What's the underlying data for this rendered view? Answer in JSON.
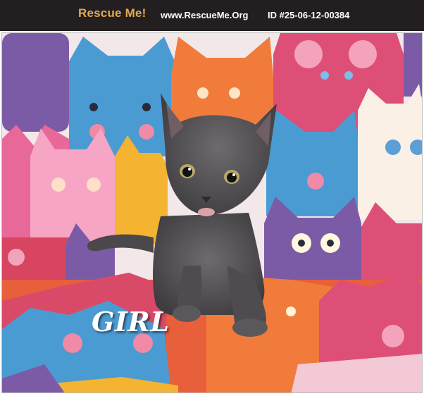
{
  "header": {
    "logo_text": "Rescue Me!",
    "site_url": "www.RescueMe.Org",
    "pet_id": "ID #25-06-12-00384"
  },
  "photo": {
    "caption": "GIRL",
    "subject": "gray-kitten",
    "background_pattern": "cartoon-cat-faces"
  },
  "colors": {
    "header_bg": "#231f20",
    "logo": "#e3a84f",
    "header_text": "#ffffff",
    "kitten_fur": "#5c5a5d"
  }
}
